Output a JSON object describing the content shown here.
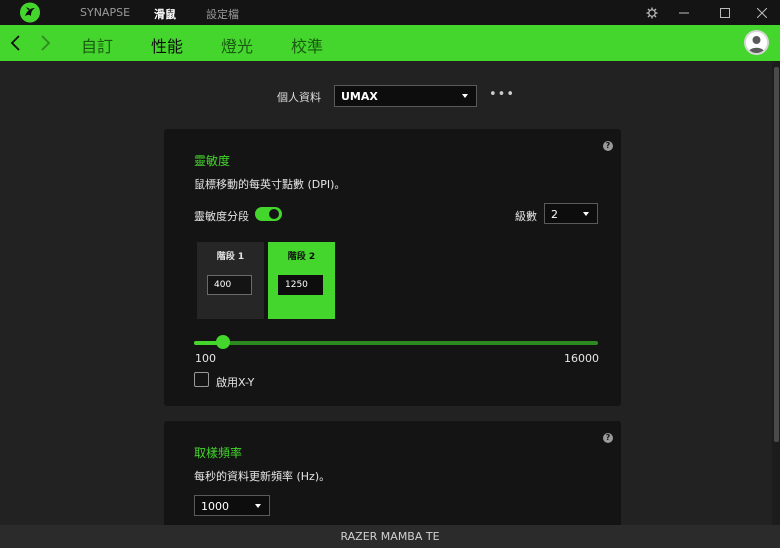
{
  "titlebar": {
    "tabs": [
      {
        "label": "SYNAPSE",
        "active": false
      },
      {
        "label": "滑鼠",
        "active": true
      },
      {
        "label": "設定檔",
        "active": false
      }
    ],
    "icons": [
      "razer-logo-icon",
      "gear-icon",
      "minimize-icon",
      "maximize-icon",
      "close-icon"
    ]
  },
  "navbar": {
    "tabs": [
      {
        "label": "自訂",
        "active": false
      },
      {
        "label": "性能",
        "active": true
      },
      {
        "label": "燈光",
        "active": false
      },
      {
        "label": "校準",
        "active": false
      }
    ]
  },
  "profile": {
    "label": "個人資料",
    "selected": "UMAX",
    "more": "•••"
  },
  "sensitivity": {
    "title": "靈敏度",
    "description": "鼠標移動的每英寸點數 (DPI)。",
    "stages_toggle_label": "靈敏度分段",
    "stages_toggle_on": true,
    "level_label": "級數",
    "level_value": "2",
    "stages": [
      {
        "label": "階段 1",
        "value": "400",
        "active": false
      },
      {
        "label": "階段 2",
        "value": "1250",
        "active": true
      }
    ],
    "slider_min": "100",
    "slider_max": "16000",
    "slider_value": 1250,
    "xy_label": "啟用X-Y",
    "xy_enabled": false,
    "help": "?"
  },
  "polling": {
    "title": "取樣頻率",
    "description": "每秒的資料更新頻率 (Hz)。",
    "value": "1000",
    "help": "?"
  },
  "footer": {
    "device_name": "RAZER MAMBA TE"
  },
  "colors": {
    "accent": "#44d62c",
    "background": "#222222",
    "card": "#141414",
    "titlebar": "#141414"
  }
}
